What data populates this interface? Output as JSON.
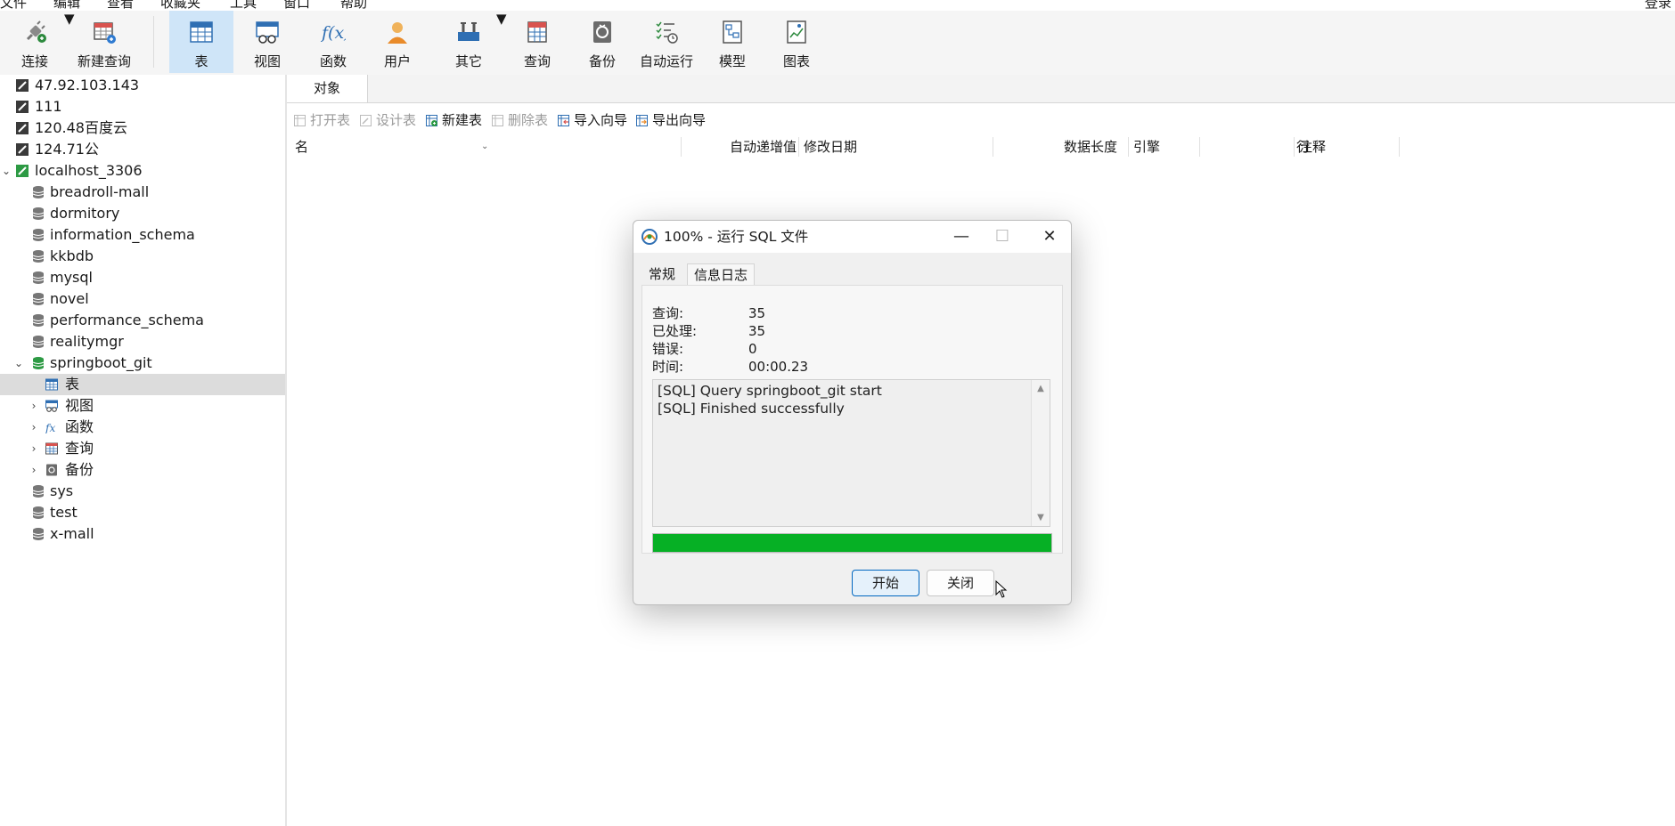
{
  "menu": [
    "文件",
    "编辑",
    "查看",
    "收藏夹",
    "工具",
    "窗口",
    "帮助"
  ],
  "login_label": "登录",
  "toolbar": [
    {
      "label": "连接",
      "icon": "plug-icon"
    },
    {
      "label": "新建查询",
      "icon": "new-query-icon"
    },
    {
      "label": "表",
      "icon": "table-icon",
      "active": true
    },
    {
      "label": "视图",
      "icon": "view-icon"
    },
    {
      "label": "函数",
      "icon": "function-icon"
    },
    {
      "label": "用户",
      "icon": "user-icon"
    },
    {
      "label": "其它",
      "icon": "tools-icon"
    },
    {
      "label": "查询",
      "icon": "query-icon"
    },
    {
      "label": "备份",
      "icon": "backup-icon"
    },
    {
      "label": "自动运行",
      "icon": "automation-icon"
    },
    {
      "label": "模型",
      "icon": "model-icon"
    },
    {
      "label": "图表",
      "icon": "chart-icon"
    }
  ],
  "sidebar": {
    "items": [
      {
        "label": "47.92.103.143",
        "type": "connection"
      },
      {
        "label": "111",
        "type": "connection"
      },
      {
        "label": "120.48百度云",
        "type": "connection"
      },
      {
        "label": "124.71公",
        "type": "connection"
      },
      {
        "label": "localhost_3306",
        "type": "connection-open",
        "expanded": true
      },
      {
        "label": "breadroll-mall",
        "type": "database"
      },
      {
        "label": "dormitory",
        "type": "database"
      },
      {
        "label": "information_schema",
        "type": "database"
      },
      {
        "label": "kkbdb",
        "type": "database"
      },
      {
        "label": "mysql",
        "type": "database"
      },
      {
        "label": "novel",
        "type": "database"
      },
      {
        "label": "performance_schema",
        "type": "database"
      },
      {
        "label": "realitymgr",
        "type": "database"
      },
      {
        "label": "springboot_git",
        "type": "database-open",
        "expanded": true
      },
      {
        "label": "表",
        "type": "tables",
        "selected": true
      },
      {
        "label": "视图",
        "type": "views"
      },
      {
        "label": "函数",
        "type": "functions"
      },
      {
        "label": "查询",
        "type": "queries"
      },
      {
        "label": "备份",
        "type": "backups"
      },
      {
        "label": "sys",
        "type": "database"
      },
      {
        "label": "test",
        "type": "database"
      },
      {
        "label": "x-mall",
        "type": "database"
      }
    ]
  },
  "main": {
    "tab": "对象",
    "actions": [
      {
        "label": "打开表",
        "enabled": false
      },
      {
        "label": "设计表",
        "enabled": false
      },
      {
        "label": "新建表",
        "enabled": true
      },
      {
        "label": "删除表",
        "enabled": false
      },
      {
        "label": "导入向导",
        "enabled": true
      },
      {
        "label": "导出向导",
        "enabled": true
      }
    ],
    "columns": [
      "名",
      "自动递增值",
      "修改日期",
      "数据长度",
      "引擎",
      "行",
      "注释"
    ]
  },
  "dialog": {
    "title": "100% - 运行 SQL 文件",
    "tabs": [
      "常规",
      "信息日志"
    ],
    "active_tab": "信息日志",
    "stats": [
      {
        "label": "查询:",
        "value": "35"
      },
      {
        "label": "已处理:",
        "value": "35"
      },
      {
        "label": "错误:",
        "value": "0"
      },
      {
        "label": "时间:",
        "value": "00:00.23"
      }
    ],
    "log": [
      "[SQL] Query springboot_git start",
      "[SQL] Finished successfully"
    ],
    "progress": 1.0,
    "buttons": {
      "start": "开始",
      "close": "关闭"
    },
    "colors": {
      "progress": "#06b025",
      "selected_bg": "#dcdcdc",
      "active_tool_bg": "#cfe5f8"
    }
  }
}
